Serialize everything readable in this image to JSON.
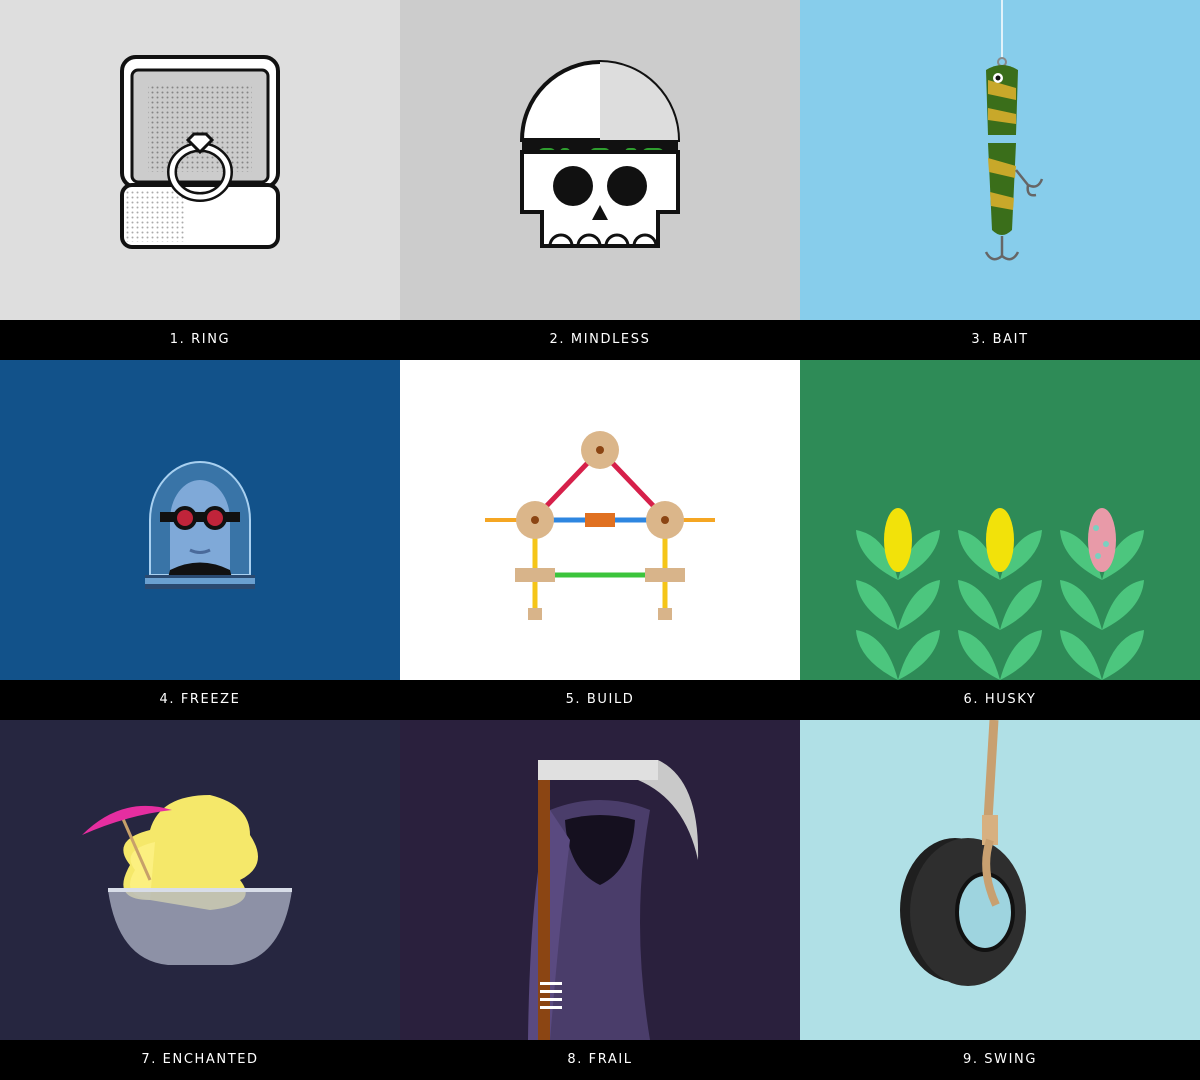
{
  "tiles": [
    {
      "label": "1. RING",
      "icon": "ring-box-icon",
      "bg": "#dedede"
    },
    {
      "label": "2. MINDLESS",
      "icon": "skull-icon",
      "bg": "#cccccc"
    },
    {
      "label": "3. BAIT",
      "icon": "fishing-lure-icon",
      "bg": "#87cdeb"
    },
    {
      "label": "4. FREEZE",
      "icon": "frozen-head-icon",
      "bg": "#12528a"
    },
    {
      "label": "5. BUILD",
      "icon": "tinker-toy-icon",
      "bg": "#ffffff"
    },
    {
      "label": "6. HUSKY",
      "icon": "corn-stalks-icon",
      "bg": "#2e8b57"
    },
    {
      "label": "7. ENCHANTED",
      "icon": "dole-whip-icon",
      "bg": "#262640"
    },
    {
      "label": "8. FRAIL",
      "icon": "grim-reaper-icon",
      "bg": "#2a203d"
    },
    {
      "label": "9. SWING",
      "icon": "tire-swing-icon",
      "bg": "#b0e0e6"
    }
  ]
}
